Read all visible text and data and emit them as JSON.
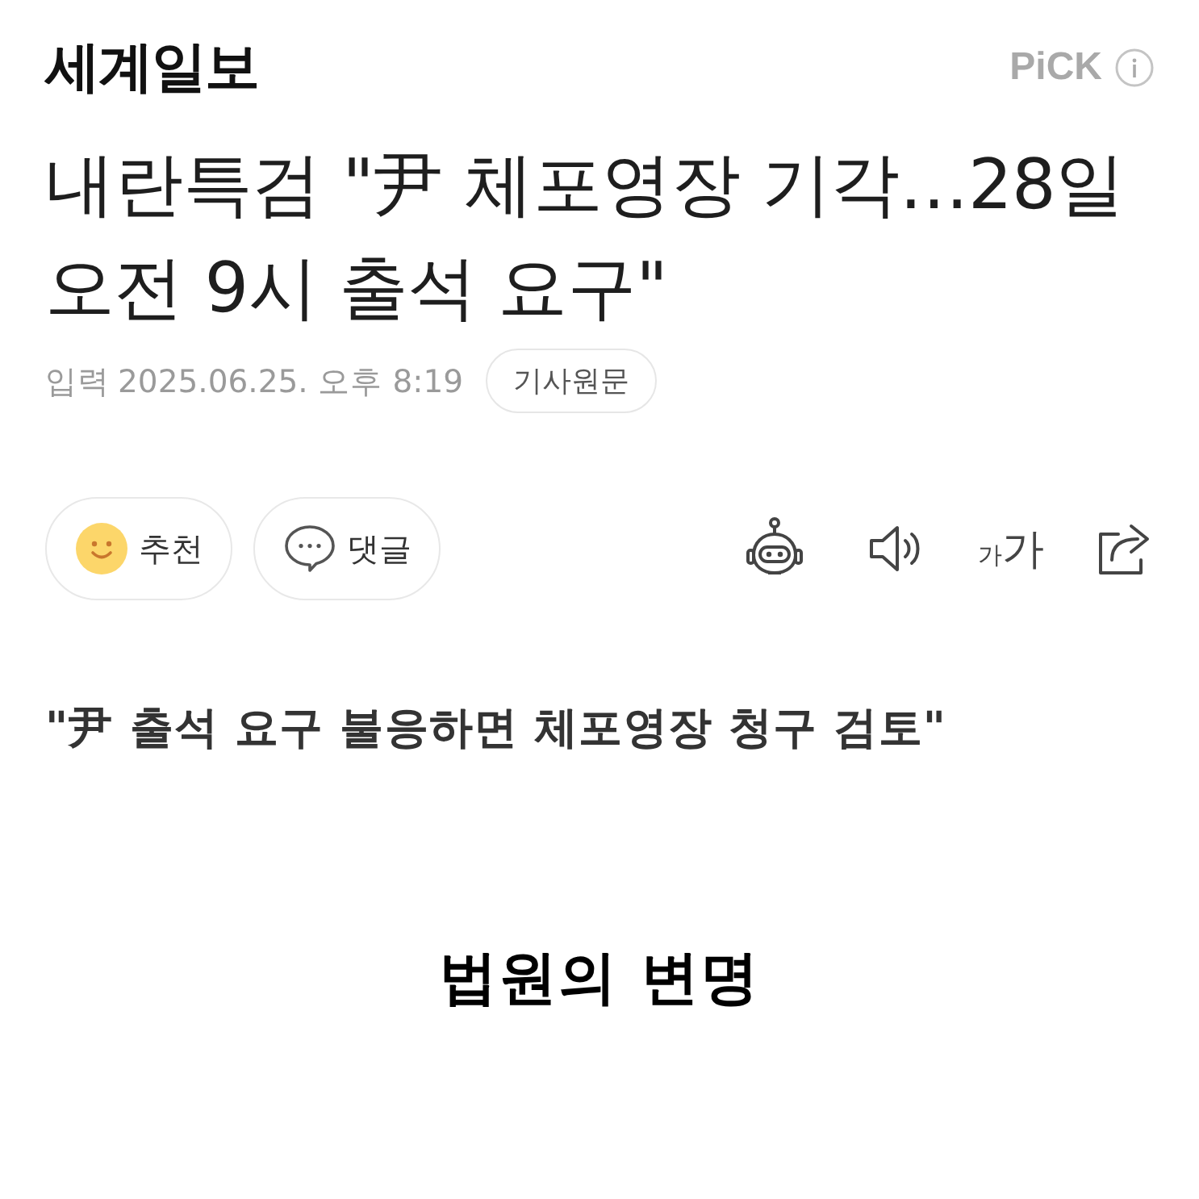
{
  "header": {
    "logo": "세계일보",
    "badge": "PiCK"
  },
  "headline": "내란특검 \"尹 체포영장 기각…28일 오전 9시 출석 요구\"",
  "meta": {
    "label": "입력",
    "timestamp": "2025.06.25. 오후 8:19",
    "source_button": "기사원문"
  },
  "actions": [
    {
      "kind": "recommend",
      "label": "추천"
    },
    {
      "kind": "comment",
      "label": "댓글"
    }
  ],
  "toolbar": {
    "text_size_small": "가",
    "text_size_large": "가"
  },
  "subtitle": "\"尹 출석 요구 불응하면 체포영장 청구 검토\"",
  "caption": "법원의 변명"
}
